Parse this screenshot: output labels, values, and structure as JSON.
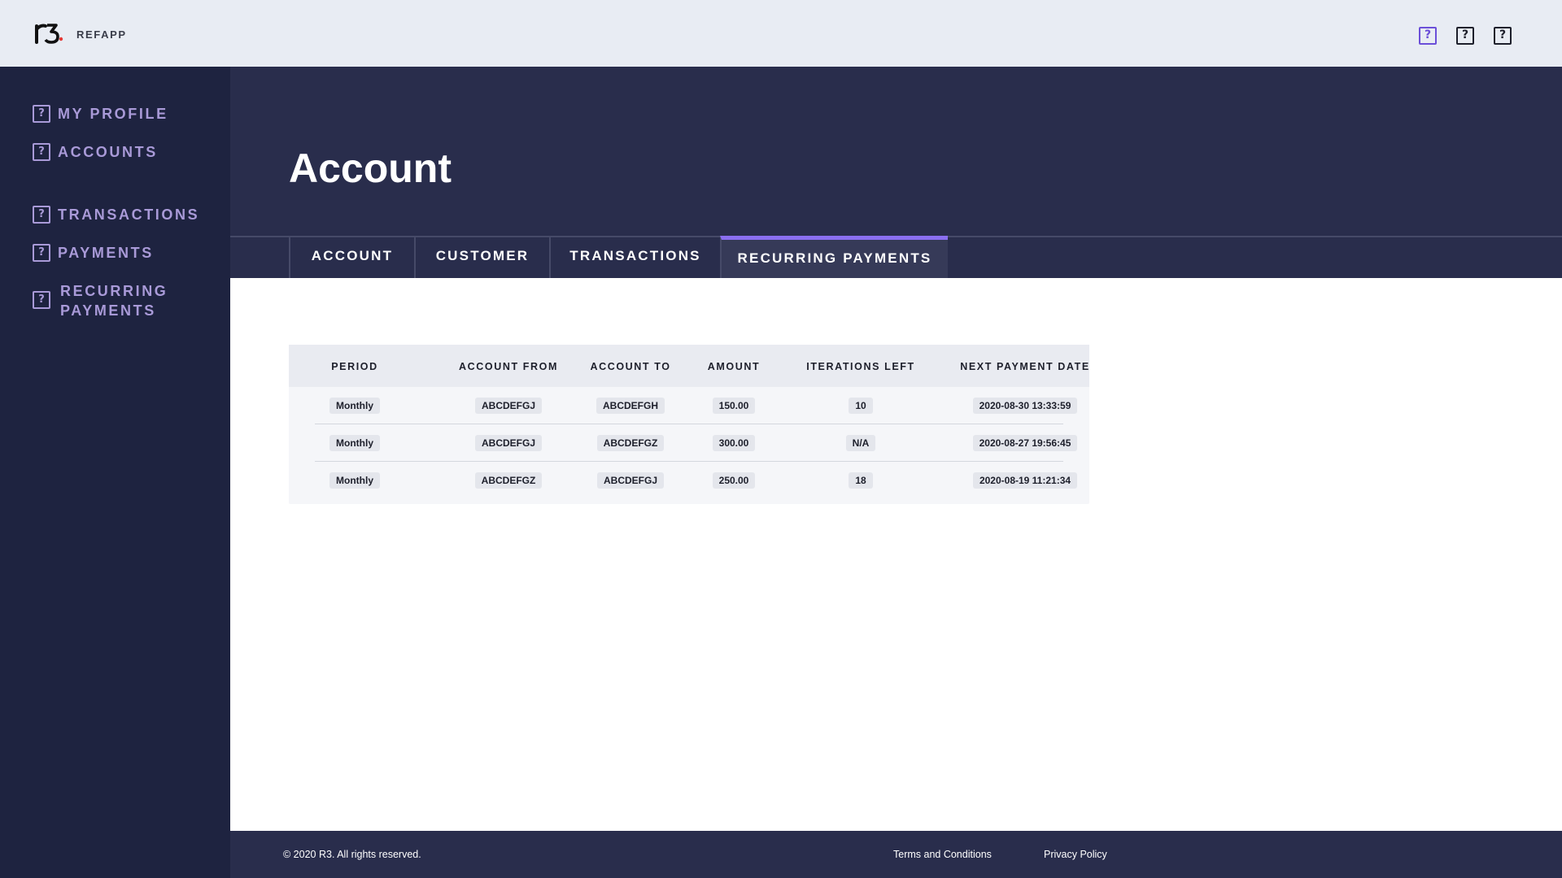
{
  "app": {
    "brand": "REFAPP",
    "header_icons": [
      "help-icon-active",
      "help-icon",
      "help-icon"
    ]
  },
  "sidebar": {
    "items": [
      {
        "label": "MY PROFILE",
        "icon": "help-icon"
      },
      {
        "label": "ACCOUNTS",
        "icon": "help-icon"
      },
      {
        "label": "TRANSACTIONS",
        "icon": "help-icon"
      },
      {
        "label": "PAYMENTS",
        "icon": "help-icon"
      },
      {
        "label": "RECURRING PAYMENTS",
        "icon": "help-icon"
      }
    ]
  },
  "page": {
    "title": "Account"
  },
  "tabs": [
    {
      "label": "ACCOUNT",
      "active": false
    },
    {
      "label": "CUSTOMER",
      "active": false
    },
    {
      "label": "TRANSACTIONS",
      "active": false
    },
    {
      "label": "RECURRING PAYMENTS",
      "active": true
    }
  ],
  "table": {
    "columns": [
      "PERIOD",
      "ACCOUNT FROM",
      "ACCOUNT TO",
      "AMOUNT",
      "ITERATIONS LEFT",
      "NEXT PAYMENT DATE"
    ],
    "rows": [
      [
        "Monthly",
        "ABCDEFGJ",
        "ABCDEFGH",
        "150.00",
        "10",
        "2020-08-30 13:33:59"
      ],
      [
        "Monthly",
        "ABCDEFGJ",
        "ABCDEFGZ",
        "300.00",
        "N/A",
        "2020-08-27 19:56:45"
      ],
      [
        "Monthly",
        "ABCDEFGZ",
        "ABCDEFGJ",
        "250.00",
        "18",
        "2020-08-19 11:21:34"
      ]
    ]
  },
  "footer": {
    "copyright": "© 2020 R3. All rights reserved.",
    "terms": "Terms and Conditions",
    "privacy": "Privacy Policy"
  },
  "colors": {
    "sidebar_bg": "#1e2340",
    "hero_bg": "#292d4c",
    "accent": "#8a6ff0",
    "nav_text": "#a99ad8"
  }
}
